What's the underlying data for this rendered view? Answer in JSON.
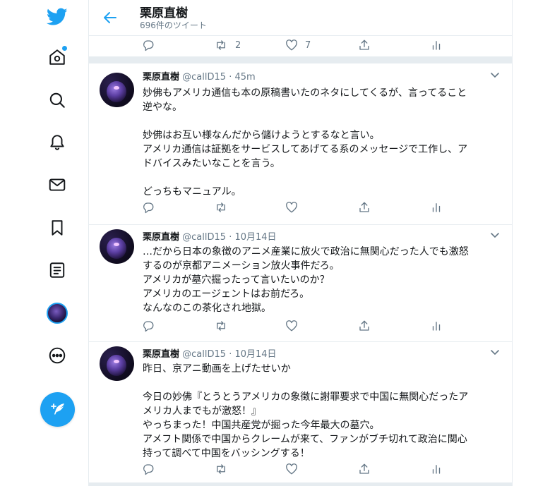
{
  "header": {
    "title": "栗原直樹",
    "tweet_count": "696件のツイート"
  },
  "top_actions": {
    "retweets": "2",
    "likes": "7"
  },
  "tweets": [
    {
      "name": "栗原直樹",
      "handle": "@callD15",
      "dot": "·",
      "time": "45m",
      "text": "妙佛もアメリカ通信も本の原稿書いたのネタにしてくるが、言ってること\n逆やな。\n\n妙佛はお互い様なんだから儲けようとするなと言い。\nアメリカ通信は証拠をサービスしてあげてる系のメッセージで工作し、ア\nドバイスみたいなことを言う。\n\nどっちもマニュアル。"
    },
    {
      "name": "栗原直樹",
      "handle": "@callD15",
      "dot": "·",
      "time": "10月14日",
      "text": "…だから日本の象徴のアニメ産業に放火で政治に無関心だった人でも激怒\nするのが京都アニメーション放火事件だろ。\nアメリカが墓穴掘ったって言いたいのか？\nアメリカのエージェントはお前だろ。\nなんなのこの茶化され地獄。"
    },
    {
      "name": "栗原直樹",
      "handle": "@callD15",
      "dot": "·",
      "time": "10月14日",
      "text": "昨日、京アニ動画を上げたせいか\n\n今日の妙佛『とうとうアメリカの象徴に謝罪要求で中国に無関心だったア\nメリカ人までもが激怒！』\nやっちまった！中国共産党が掘った今年最大の墓穴。\nアメフト関係で中国からクレームが来て、ファンがブチ切れて政治に関心\n持って調べて中国をバッシングする！"
    }
  ],
  "icons": {
    "brand": "twitter-bird-icon",
    "nav": [
      "home-icon",
      "explore-icon",
      "notifications-icon",
      "messages-icon",
      "bookmarks-icon",
      "lists-icon",
      "profile-avatar",
      "more-icon"
    ],
    "compose": "compose-tweet-icon"
  },
  "colors": {
    "accent": "#1da1f2",
    "text": "#14171a",
    "muted": "#657786",
    "border": "#e6ecf0"
  }
}
